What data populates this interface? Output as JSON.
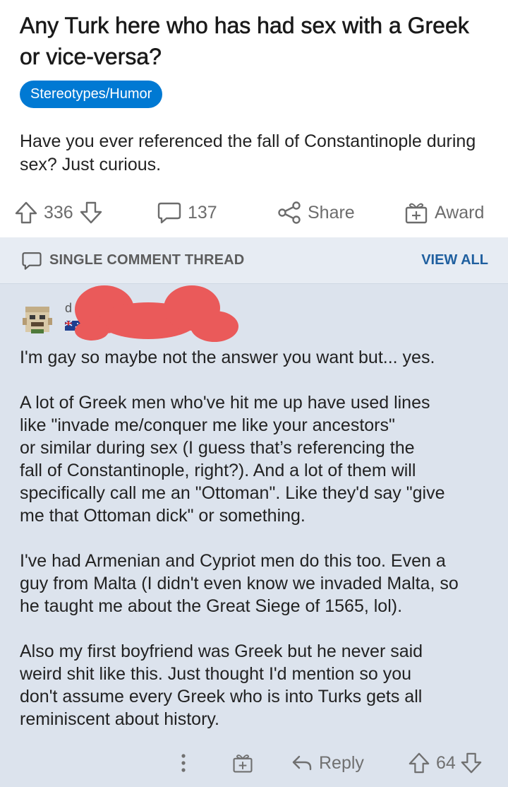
{
  "post": {
    "title": "Any Turk here who has had sex with a Greek or vice-versa?",
    "flair": "Stereotypes/Humor",
    "body": "Have you ever referenced the fall of Constantinople during sex? Just curious.",
    "actions": {
      "upvotes": "336",
      "comments": "137",
      "share_label": "Share",
      "award_label": "Award"
    }
  },
  "thread": {
    "label": "SINGLE COMMENT THREAD",
    "view_all": "VIEW ALL"
  },
  "comment": {
    "username_visible": "d",
    "paragraphs": [
      "I'm gay so maybe not the answer you want but... yes.",
      "A lot of Greek men who've hit me up have used lines\nlike \"invade me/conquer me like your ancestors\"\nor similar during sex (I guess that’s referencing the\nfall of Constantinople, right?). And a lot of them will\nspecifically call me an \"Ottoman\". Like they'd say \"give\nme that Ottoman dick\" or something.",
      "I've had Armenian and Cypriot men do this too. Even a\nguy from Malta (I didn't even know we invaded Malta, so\nhe taught me about the Great Siege of 1565, lol).",
      "Also my first boyfriend was Greek but he never said\nweird shit like this. Just thought I'd mention so you\ndon't assume every Greek who is into Turks gets all\nreminiscent about history."
    ],
    "actions": {
      "reply_label": "Reply",
      "votes": "64"
    }
  },
  "colors": {
    "flair_bg": "#0079d3",
    "view_all": "#1f5f9f",
    "comment_bg": "#dce3ed",
    "redaction": "#ea5a5a"
  },
  "icons": [
    "upvote-icon",
    "downvote-icon",
    "comment-icon",
    "share-icon",
    "award-icon",
    "more-icon",
    "reply-icon",
    "avatar",
    "flag-icon"
  ]
}
